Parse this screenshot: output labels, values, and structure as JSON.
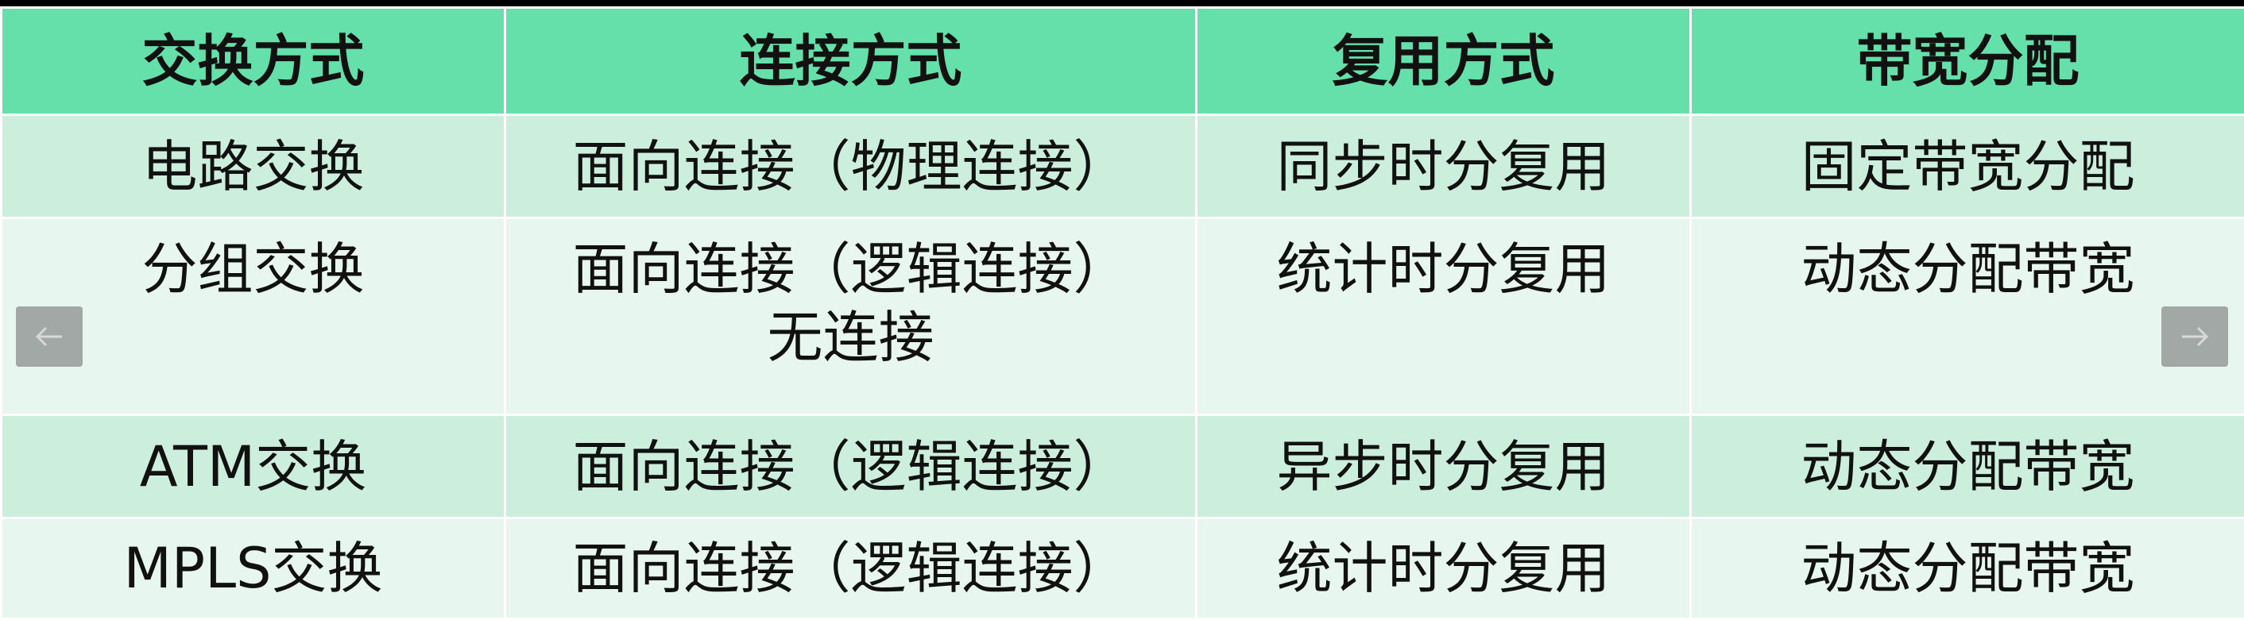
{
  "table": {
    "headers": [
      "交换方式",
      "连接方式",
      "复用方式",
      "带宽分配"
    ],
    "rows": [
      {
        "switching": "电路交换",
        "connection": [
          "面向连接（物理连接）"
        ],
        "multiplexing": "同步时分复用",
        "bandwidth": "固定带宽分配"
      },
      {
        "switching": "分组交换",
        "connection": [
          "面向连接（逻辑连接）",
          "无连接"
        ],
        "multiplexing": "统计时分复用",
        "bandwidth": "动态分配带宽"
      },
      {
        "switching": "ATM交换",
        "connection": [
          "面向连接（逻辑连接）"
        ],
        "multiplexing": "异步时分复用",
        "bandwidth": "动态分配带宽"
      },
      {
        "switching": "MPLS交换",
        "connection": [
          "面向连接（逻辑连接）"
        ],
        "multiplexing": "统计时分复用",
        "bandwidth": "动态分配带宽"
      }
    ]
  },
  "navigation": {
    "prev_icon": "arrow-left-icon",
    "next_icon": "arrow-right-icon"
  },
  "colors": {
    "header_bg": "#66e0ab",
    "row_alt_1": "#cbeedd",
    "row_alt_2": "#e7f7ef",
    "frame": "#000000"
  }
}
